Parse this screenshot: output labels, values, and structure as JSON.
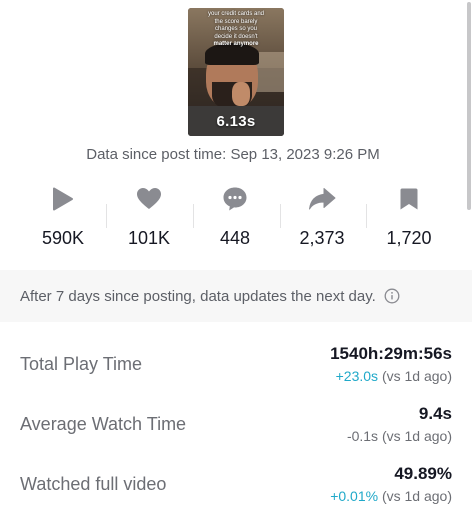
{
  "video": {
    "caption_lines": [
      "your credit cards and",
      "the score barely",
      "changes so you",
      "decide it doesn't"
    ],
    "caption_bold": "matter anymore",
    "duration": "6.13s"
  },
  "post_time": "Data since post time: Sep 13, 2023 9:26 PM",
  "stats": {
    "plays": "590K",
    "likes": "101K",
    "comments": "448",
    "shares": "2,373",
    "saves": "1,720"
  },
  "notice": "After 7 days since posting, data updates the next day.",
  "metrics": [
    {
      "label": "Total Play Time",
      "value": "1540h:29m:56s",
      "delta": "+23.0s",
      "delta_suffix": " (vs 1d ago)"
    },
    {
      "label": "Average Watch Time",
      "value": "9.4s",
      "delta": "-0.1s",
      "delta_suffix": " (vs 1d ago)"
    },
    {
      "label": "Watched full video",
      "value": "49.89%",
      "delta": "+0.01%",
      "delta_suffix": " (vs 1d ago)"
    }
  ],
  "colors": {
    "positive_delta": "#20a9c9",
    "icon_gray": "#8a8b91",
    "text_primary": "#161823"
  },
  "icons": [
    "play-icon",
    "heart-icon",
    "comment-icon",
    "share-icon",
    "bookmark-icon",
    "info-icon"
  ]
}
